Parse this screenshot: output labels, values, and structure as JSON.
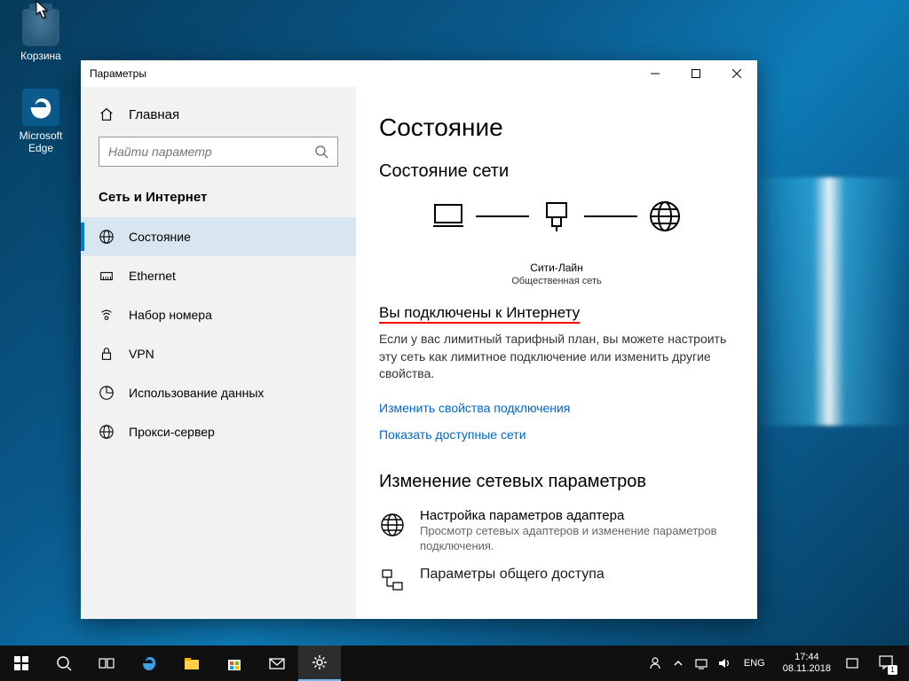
{
  "desktop": {
    "icons": [
      {
        "label": "Корзина"
      },
      {
        "label": "Microsoft Edge"
      }
    ]
  },
  "window": {
    "title": "Параметры",
    "sidebar": {
      "home": "Главная",
      "search_placeholder": "Найти параметр",
      "category": "Сеть и Интернет",
      "items": [
        {
          "label": "Состояние"
        },
        {
          "label": "Ethernet"
        },
        {
          "label": "Набор номера"
        },
        {
          "label": "VPN"
        },
        {
          "label": "Использование данных"
        },
        {
          "label": "Прокси-сервер"
        }
      ]
    },
    "content": {
      "title": "Состояние",
      "net_status_heading": "Состояние сети",
      "net_name": "Сити-Лайн",
      "net_type": "Общественная сеть",
      "connected_line": "Вы подключены к Интернету",
      "connected_para": "Если у вас лимитный тарифный план, вы можете настроить эту сеть как лимитное подключение или изменить другие свойства.",
      "link_change_props": "Изменить свойства подключения",
      "link_show_nets": "Показать доступные сети",
      "change_heading": "Изменение сетевых параметров",
      "adapter_title": "Настройка параметров адаптера",
      "adapter_desc": "Просмотр сетевых адаптеров и изменение параметров подключения.",
      "sharing_title": "Параметры общего доступа"
    }
  },
  "taskbar": {
    "lang": "ENG",
    "time": "17:44",
    "date": "08.11.2018",
    "notif_count": "1"
  }
}
